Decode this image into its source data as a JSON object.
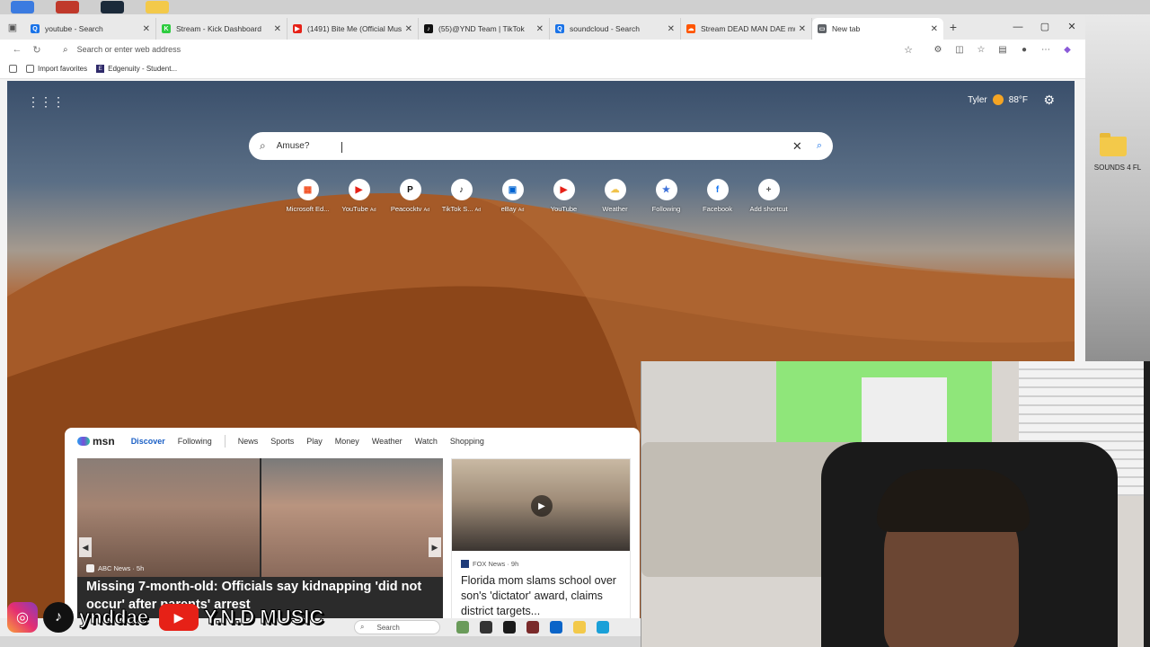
{
  "browser": {
    "tabs": [
      {
        "title": "youtube - Search",
        "favicon_color": "#1a73e8",
        "favicon_glyph": "Q",
        "active": false
      },
      {
        "title": "Stream - Kick Dashboard",
        "favicon_color": "#2ecc40",
        "favicon_glyph": "K",
        "active": false
      },
      {
        "title": "(1491) Bite Me (Official Music",
        "favicon_color": "#e62117",
        "favicon_glyph": "▶",
        "active": false
      },
      {
        "title": "(55)@YND Team | TikTok",
        "favicon_color": "#111111",
        "favicon_glyph": "♪",
        "active": false
      },
      {
        "title": "soundcloud - Search",
        "favicon_color": "#1a73e8",
        "favicon_glyph": "Q",
        "active": false
      },
      {
        "title": "Stream DEAD MAN DAE musi",
        "favicon_color": "#ff5500",
        "favicon_glyph": "☁",
        "active": false
      },
      {
        "title": "New tab",
        "favicon_color": "#5f6368",
        "favicon_glyph": "▭",
        "active": true
      }
    ],
    "address_placeholder": "Search or enter web address",
    "favorites": [
      {
        "label": "Import favorites"
      },
      {
        "label": "Edgenuity - Student..."
      }
    ]
  },
  "ntp": {
    "user_name": "Tyler",
    "temperature": "88°F",
    "search_value": "Amuse?",
    "shortcuts": [
      {
        "label": "Microsoft Ed...",
        "ad": "",
        "glyph": "▦",
        "color": "#f25022"
      },
      {
        "label": "YouTube",
        "ad": "Ad",
        "glyph": "▶",
        "color": "#e62117"
      },
      {
        "label": "Peacocktv",
        "ad": "Ad",
        "glyph": "P",
        "color": "#111111"
      },
      {
        "label": "TikTok S...",
        "ad": "Ad",
        "glyph": "♪",
        "color": "#111111"
      },
      {
        "label": "eBay",
        "ad": "Ad",
        "glyph": "▣",
        "color": "#0064d2"
      },
      {
        "label": "YouTube",
        "ad": "",
        "glyph": "▶",
        "color": "#e62117"
      },
      {
        "label": "Weather",
        "ad": "",
        "glyph": "☁",
        "color": "#f0c24a"
      },
      {
        "label": "Following",
        "ad": "",
        "glyph": "★",
        "color": "#3b6fd8"
      },
      {
        "label": "Facebook",
        "ad": "",
        "glyph": "f",
        "color": "#1877f2"
      },
      {
        "label": "Add shortcut",
        "ad": "",
        "glyph": "+",
        "color": "#555555"
      }
    ]
  },
  "msn": {
    "logo": "msn",
    "tabs": [
      "Discover",
      "Following",
      "News",
      "Sports",
      "Play",
      "Money",
      "Weather",
      "Watch",
      "Shopping"
    ],
    "big_card": {
      "source": "ABC News · 5h",
      "headline": "Missing 7-month-old: Officials say kidnapping 'did not occur' after parents' arrest"
    },
    "small_card": {
      "source": "FOX News · 9h",
      "headline": "Florida mom slams school over son's 'dictator' award, claims district targets..."
    }
  },
  "desktop": {
    "folder_label": "SOUNDS 4 FL"
  },
  "taskbar": {
    "search_label": "Search"
  },
  "overlay": {
    "handle": "ynddae",
    "channel": "Y.N.D MUSIC"
  }
}
